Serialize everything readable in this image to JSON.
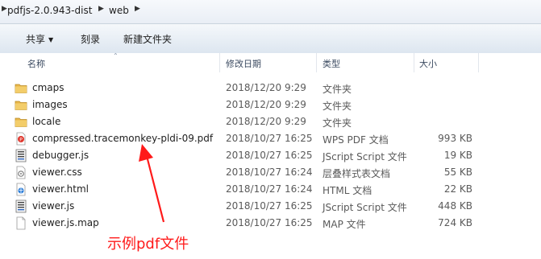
{
  "breadcrumb": {
    "folder": "pdfjs-2.0.943-dist",
    "subfolder": "web"
  },
  "toolbar": {
    "share": "共享",
    "burn": "刻录",
    "new_folder": "新建文件夹"
  },
  "columns": {
    "name": "名称",
    "date": "修改日期",
    "type": "类型",
    "size": "大小"
  },
  "files": [
    {
      "name": "cmaps",
      "date": "2018/12/20 9:29",
      "type": "文件夹",
      "size": "",
      "icon": "folder-icon"
    },
    {
      "name": "images",
      "date": "2018/12/20 9:29",
      "type": "文件夹",
      "size": "",
      "icon": "folder-icon"
    },
    {
      "name": "locale",
      "date": "2018/12/20 9:29",
      "type": "文件夹",
      "size": "",
      "icon": "folder-icon"
    },
    {
      "name": "compressed.tracemonkey-pldi-09.pdf",
      "date": "2018/10/27 16:25",
      "type": "WPS PDF 文档",
      "size": "993 KB",
      "icon": "pdf-file-icon"
    },
    {
      "name": "debugger.js",
      "date": "2018/10/27 16:25",
      "type": "JScript Script 文件",
      "size": "19 KB",
      "icon": "script-file-icon"
    },
    {
      "name": "viewer.css",
      "date": "2018/10/27 16:24",
      "type": "层叠样式表文档",
      "size": "55 KB",
      "icon": "css-file-icon"
    },
    {
      "name": "viewer.html",
      "date": "2018/10/27 16:24",
      "type": "HTML 文档",
      "size": "22 KB",
      "icon": "html-file-icon"
    },
    {
      "name": "viewer.js",
      "date": "2018/10/27 16:25",
      "type": "JScript Script 文件",
      "size": "448 KB",
      "icon": "script-file-icon"
    },
    {
      "name": "viewer.js.map",
      "date": "2018/10/27 16:25",
      "type": "MAP 文件",
      "size": "724 KB",
      "icon": "blank-file-icon"
    }
  ],
  "annotation": {
    "text": "示例pdf文件",
    "color": "#ff1a1a"
  }
}
